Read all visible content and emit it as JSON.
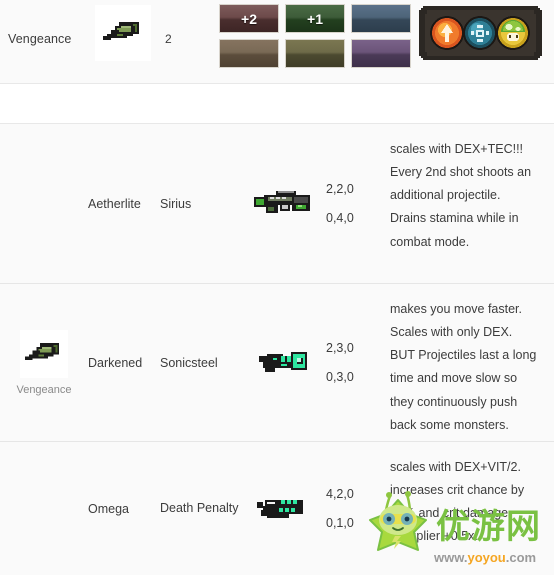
{
  "header": {
    "item_name": "Vengeance",
    "thumb_icon": "green-pixel-weapon-icon",
    "count": "2",
    "swatches": [
      {
        "name": "swatch-maroon",
        "label": "+2",
        "color": "#5a3a3a"
      },
      {
        "name": "swatch-green",
        "label": "+1",
        "color": "#2e4a2a"
      },
      {
        "name": "swatch-blue",
        "label": "",
        "color": "#415567"
      },
      {
        "name": "swatch-brown",
        "label": "",
        "color": "#6b5a47"
      },
      {
        "name": "swatch-olive",
        "label": "",
        "color": "#5d5a3c"
      },
      {
        "name": "swatch-purple",
        "label": "",
        "color": "#5a4566"
      }
    ],
    "orbs": [
      {
        "name": "orb-fire-arrow-icon",
        "color": "#e8642a"
      },
      {
        "name": "orb-water-dots-icon",
        "color": "#2e7f96"
      },
      {
        "name": "orb-mushroom-icon",
        "color": "#8ec63f"
      }
    ]
  },
  "table": {
    "rows": [
      {
        "icon_caption": "",
        "icon_name": "",
        "prefix": "Aetherlite",
        "suffix": "Sirius",
        "sprite": "rifle-sprite-green",
        "stat_line_1": "2,2,0",
        "stat_line_2": "0,4,0",
        "description": "scales with DEX+TEC!!! Every 2nd shot shoots an additional projectile. Drains stamina while in combat mode."
      },
      {
        "icon_caption": "Vengeance",
        "icon_name": "green-pixel-weapon-icon",
        "prefix": "Darkened",
        "suffix": "Sonicsteel",
        "sprite": "pistol-sprite-teal",
        "stat_line_1": "2,3,0",
        "stat_line_2": "0,3,0",
        "description": "makes you move faster. Scales with only DEX. BUT Projectiles last a long time and move slow so they continuously push back some monsters."
      },
      {
        "icon_caption": "",
        "icon_name": "",
        "prefix": "Omega",
        "suffix": "Death Penalty",
        "sprite": "cannon-sprite-teal",
        "stat_line_1": "4,2,0",
        "stat_line_2": "0,1,0",
        "description": "scales with DEX+VIT/2. increases crit chance by 10% and crit damage multiplier +0.5x."
      }
    ]
  },
  "watermark": {
    "brand_cn": "优游网",
    "brand_url": "www.yoyou.com",
    "mascot": "green-star-mascot-icon",
    "brand_color": "#7ac143",
    "url_color": "#f5a623"
  }
}
